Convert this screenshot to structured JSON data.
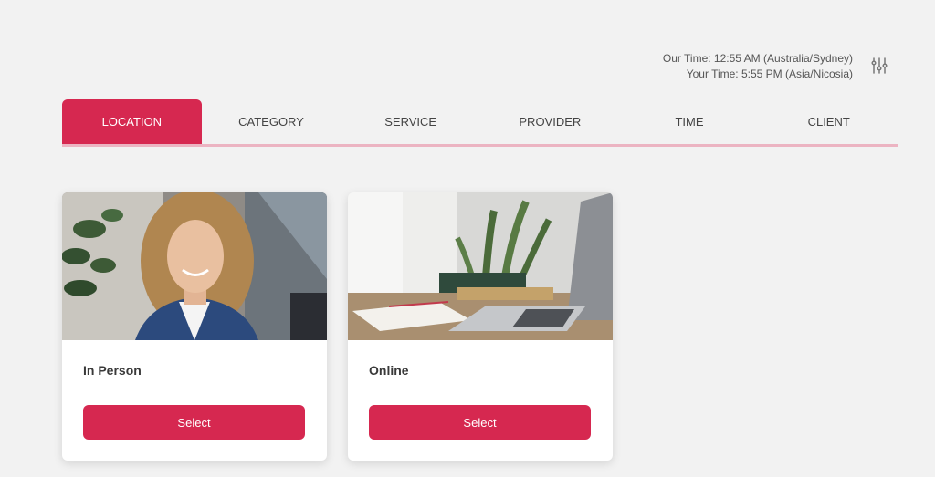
{
  "time": {
    "our_time": "Our Time: 12:55 AM (Australia/Sydney)",
    "your_time": "Your Time: 5:55 PM (Asia/Nicosia)",
    "settings_icon": "sliders-icon"
  },
  "steps": [
    {
      "label": "LOCATION",
      "active": true
    },
    {
      "label": "CATEGORY",
      "active": false
    },
    {
      "label": "SERVICE",
      "active": false
    },
    {
      "label": "PROVIDER",
      "active": false
    },
    {
      "label": "TIME",
      "active": false
    },
    {
      "label": "CLIENT",
      "active": false
    }
  ],
  "locations": [
    {
      "name": "In Person",
      "button_label": "Select",
      "image_icon": "woman-portrait-photo"
    },
    {
      "name": "Online",
      "button_label": "Select",
      "image_icon": "laptop-desk-photo"
    }
  ],
  "colors": {
    "accent": "#d62850",
    "accent_light": "#ecb4c2",
    "background": "#f2f2f2"
  }
}
